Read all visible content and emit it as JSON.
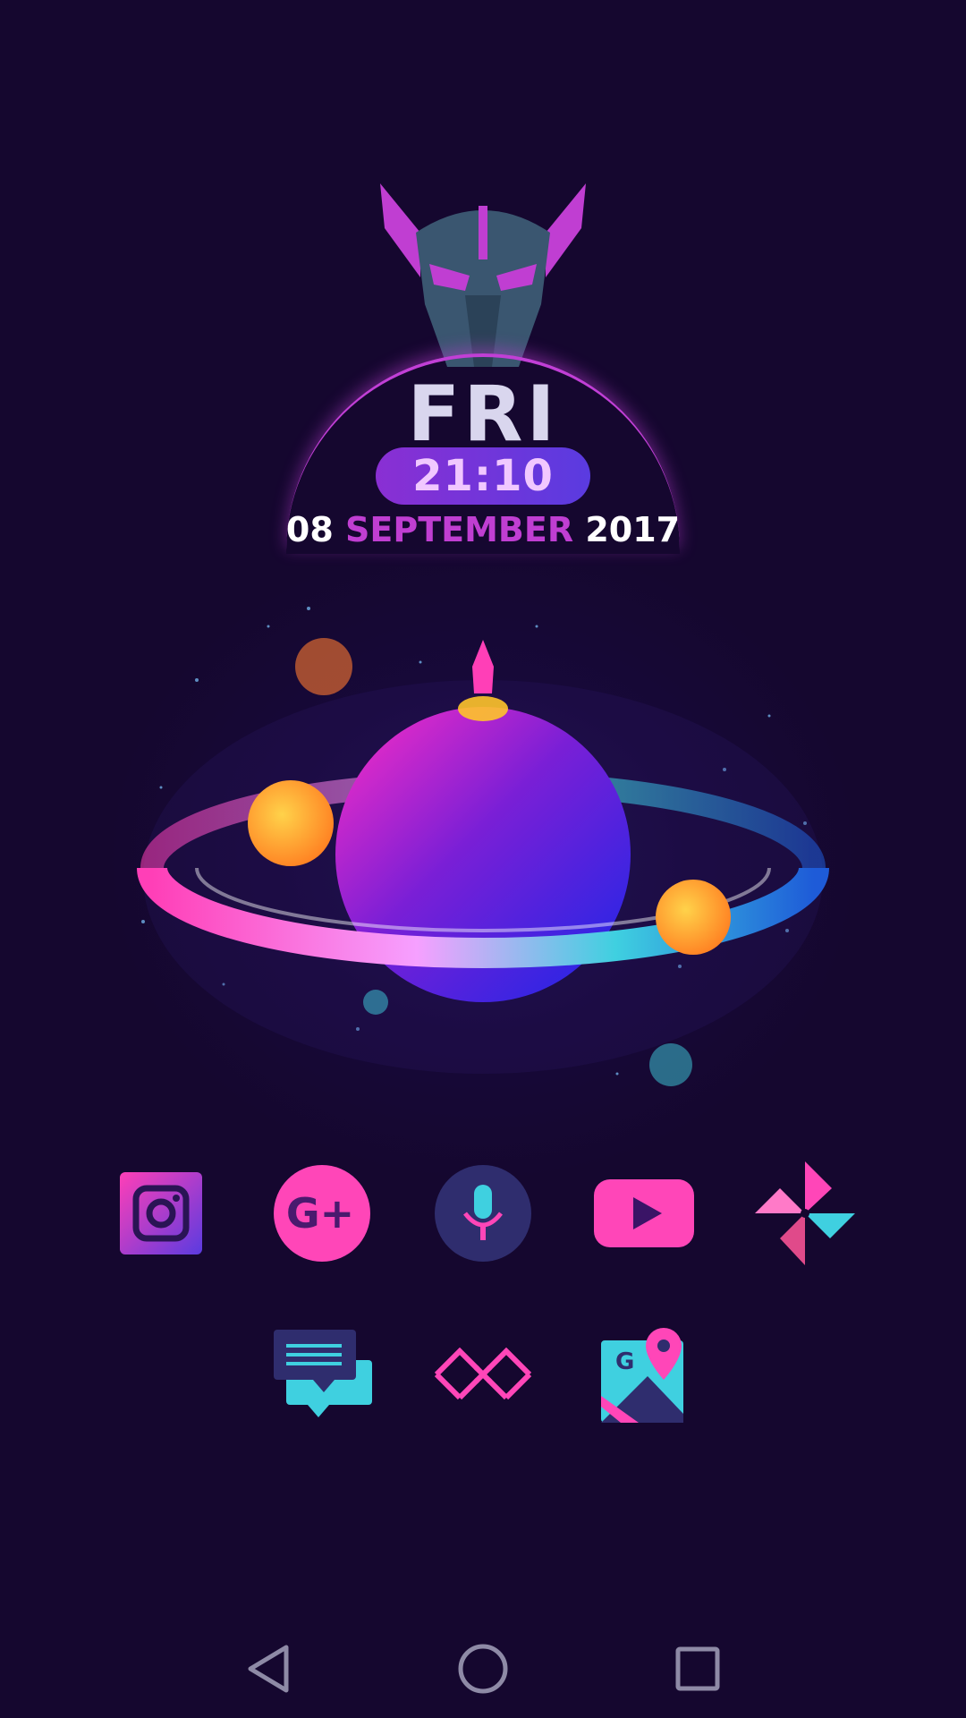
{
  "widget": {
    "day": "FRI",
    "time": "21:10",
    "date_day": "08",
    "date_month": "SEPTEMBER",
    "date_year": "2017"
  },
  "home_icons_row1": [
    {
      "icon": "instagram-icon",
      "app": "Instagram"
    },
    {
      "icon": "google-plus-icon",
      "app": "Google+"
    },
    {
      "icon": "voice-search-icon",
      "app": "Voice Search"
    },
    {
      "icon": "youtube-icon",
      "app": "YouTube"
    },
    {
      "icon": "google-photos-icon",
      "app": "Google Photos"
    }
  ],
  "home_icons_row2": [
    {
      "icon": "messages-icon",
      "app": "Messages"
    },
    {
      "icon": "chain-link-icon",
      "app": "App"
    },
    {
      "icon": "google-maps-icon",
      "app": "Google Maps"
    }
  ],
  "nav_bar": {
    "back": "back-icon",
    "home": "home-icon",
    "recents": "recents-icon"
  },
  "colors": {
    "background": "#15072f",
    "accent_magenta": "#c03ed2",
    "accent_pink": "#ff3fb7",
    "accent_cyan": "#3fd0e0",
    "accent_yellow": "#ffc42a"
  }
}
